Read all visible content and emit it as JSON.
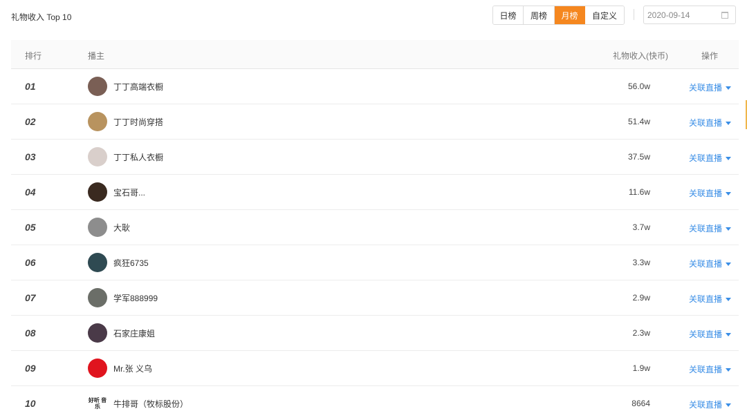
{
  "header": {
    "title": "礼物收入 Top 10",
    "tabs": [
      {
        "label": "日榜",
        "active": false
      },
      {
        "label": "周榜",
        "active": false
      },
      {
        "label": "月榜",
        "active": true
      },
      {
        "label": "自定义",
        "active": false
      }
    ],
    "date": "2020-09-14",
    "accent_color": "#f5871f"
  },
  "table": {
    "columns": {
      "rank": "排行",
      "host": "播主",
      "income": "礼物收入(快币)",
      "action": "操作"
    },
    "rows": [
      {
        "rank": "01",
        "name": "丁丁高端衣橱",
        "income": "56.0w",
        "action": "关联直播",
        "avatar": "#7a5f55"
      },
      {
        "rank": "02",
        "name": "丁丁时尚穿搭",
        "income": "51.4w",
        "action": "关联直播",
        "avatar": "#b8935f"
      },
      {
        "rank": "03",
        "name": "丁丁私人衣橱",
        "income": "37.5w",
        "action": "关联直播",
        "avatar": "#d9cfcb"
      },
      {
        "rank": "04",
        "name": "宝石哥...",
        "income": "11.6w",
        "action": "关联直播",
        "avatar": "#3a2a20"
      },
      {
        "rank": "05",
        "name": "大耿",
        "income": "3.7w",
        "action": "关联直播",
        "avatar": "#8d8d8d"
      },
      {
        "rank": "06",
        "name": "疯狂6735",
        "income": "3.3w",
        "action": "关联直播",
        "avatar": "#2f4a52"
      },
      {
        "rank": "07",
        "name": "学军888999",
        "income": "2.9w",
        "action": "关联直播",
        "avatar": "#6b6e68"
      },
      {
        "rank": "08",
        "name": "石家庄康姐",
        "income": "2.3w",
        "action": "关联直播",
        "avatar": "#4a3a48"
      },
      {
        "rank": "09",
        "name": "Mr.张 义乌",
        "income": "1.9w",
        "action": "关联直播",
        "avatar": "#e0141e"
      },
      {
        "rank": "10",
        "name": "牛排哥（牧标股份）",
        "income": "8664",
        "action": "关联直播",
        "avatar": "#ffffff",
        "avatar_text": "好听 音乐"
      }
    ]
  }
}
